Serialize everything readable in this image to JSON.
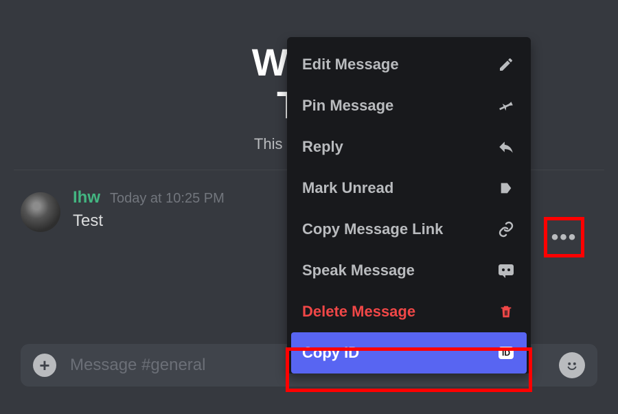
{
  "welcome": {
    "title_line1": "Welco",
    "title_line2": "Tes",
    "subtitle": "This is the begin"
  },
  "message": {
    "username": "Ihw",
    "timestamp": "Today at 10:25 PM",
    "text": "Test"
  },
  "input": {
    "placeholder": "Message #general"
  },
  "context_menu": {
    "items": [
      {
        "label": "Edit Message",
        "icon": "pencil"
      },
      {
        "label": "Pin Message",
        "icon": "pin"
      },
      {
        "label": "Reply",
        "icon": "reply"
      },
      {
        "label": "Mark Unread",
        "icon": "unread"
      },
      {
        "label": "Copy Message Link",
        "icon": "link"
      },
      {
        "label": "Speak Message",
        "icon": "speak"
      },
      {
        "label": "Delete Message",
        "icon": "trash",
        "danger": true
      },
      {
        "label": "Copy ID",
        "icon": "id",
        "selected": true
      }
    ]
  }
}
